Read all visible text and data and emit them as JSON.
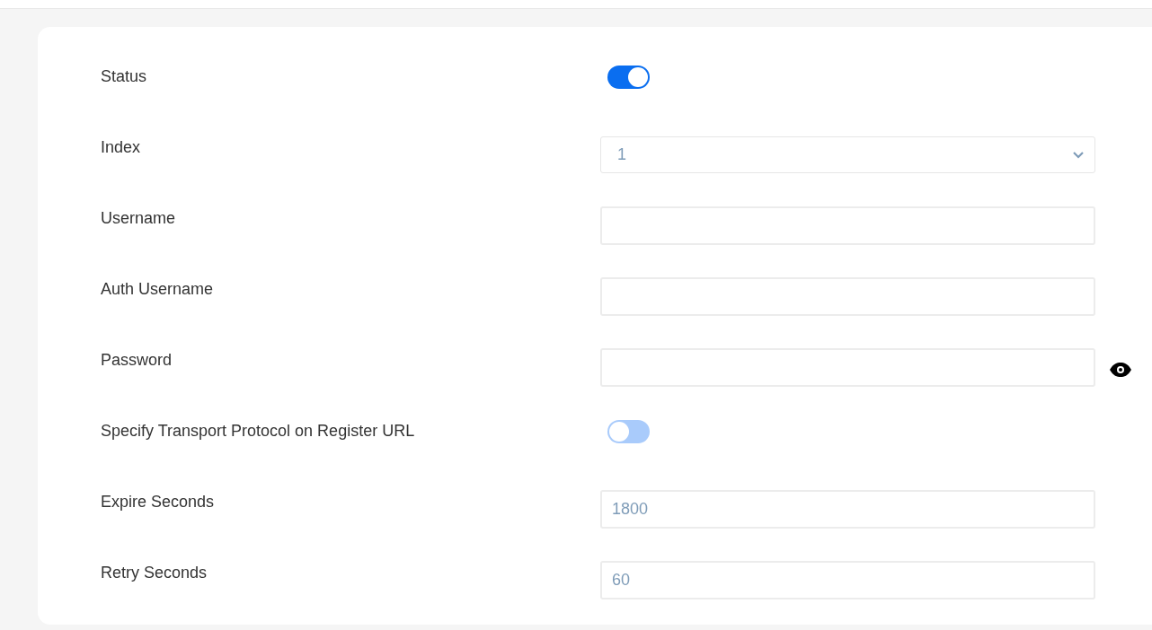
{
  "fields": [
    {
      "kind": "toggle",
      "label": "Status",
      "on": true
    },
    {
      "kind": "select",
      "label": "Index",
      "value": "1"
    },
    {
      "kind": "text",
      "label": "Username"
    },
    {
      "kind": "text",
      "label": "Auth Username"
    },
    {
      "kind": "password",
      "label": "Password"
    },
    {
      "kind": "toggle",
      "label": "Specify Transport Protocol on Register URL",
      "on": false
    },
    {
      "kind": "text",
      "label": "Expire Seconds",
      "value": "1800"
    },
    {
      "kind": "text",
      "label": "Retry Seconds",
      "value": "60"
    }
  ]
}
